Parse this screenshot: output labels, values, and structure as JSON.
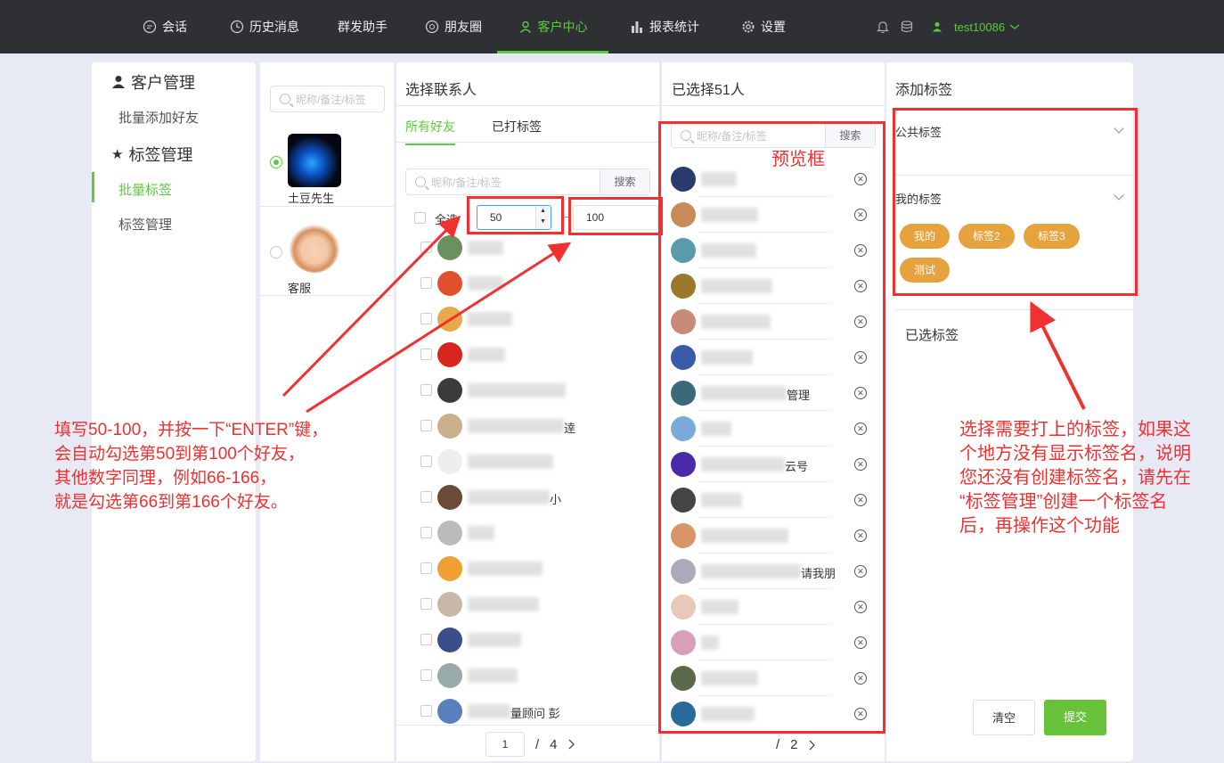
{
  "nav": {
    "items": [
      {
        "label": "会话",
        "icon": "chat-icon"
      },
      {
        "label": "历史消息",
        "icon": "clock-icon"
      },
      {
        "label": "群发助手",
        "icon": ""
      },
      {
        "label": "朋友圈",
        "icon": "aperture-icon"
      },
      {
        "label": "客户中心",
        "icon": "user-icon"
      },
      {
        "label": "报表统计",
        "icon": "bar-chart-icon"
      },
      {
        "label": "设置",
        "icon": "gear-icon"
      }
    ],
    "active_index": 4,
    "username": "test10086"
  },
  "sidebar": {
    "group1": "客户管理",
    "group1_items": [
      "批量添加好友"
    ],
    "group2": "标签管理",
    "group2_items": [
      "批量标签",
      "标签管理"
    ],
    "active_item": "批量标签"
  },
  "accounts": {
    "search_placeholder": "昵称/备注/标签",
    "list": [
      {
        "name": "土豆先生",
        "selected": true
      },
      {
        "name": "客服",
        "selected": false
      }
    ]
  },
  "contacts": {
    "title": "选择联系人",
    "tabs": [
      "所有好友",
      "已打标签"
    ],
    "search_placeholder": "昵称/备注/标签",
    "search_button": "搜索",
    "select_all": "全选",
    "range_from": "50",
    "range_to": "100",
    "visible_fragments": [
      "",
      "",
      "",
      "",
      "",
      "逹",
      "",
      "小",
      "",
      "",
      "",
      "",
      "",
      "量顾问 彭"
    ],
    "page_current": "1",
    "page_total": "4"
  },
  "selected": {
    "title": "已选择51人",
    "search_placeholder": "昵称/备注/标签",
    "search_button": "搜索",
    "visible_fragments": [
      "",
      "",
      "",
      "",
      "",
      "",
      "管理",
      "",
      "云号",
      "",
      "",
      "请我朋",
      "",
      "",
      "",
      ""
    ],
    "page_total": "2"
  },
  "tags": {
    "title": "添加标签",
    "public_label": "公共标签",
    "my_label": "我的标签",
    "my_tags": [
      "我的",
      "标签2",
      "标签3",
      "测试"
    ],
    "selected_label": "已选标签",
    "clear_button": "清空",
    "submit_button": "提交"
  },
  "annotations": {
    "left_note": [
      "填写50-100，并按一下“ENTER”键，",
      "会自动勾选第50到第100个好友，",
      "其他数字同理，例如66-166，",
      "就是勾选第66到第166个好友。"
    ],
    "preview_label": "预览框",
    "right_note": [
      "选择需要打上的标签，如果这",
      "个地方没有显示标签名，说明",
      "您还没有创建标签名，请先在",
      "“标签管理”创建一个标签名",
      "后，再操作这个功能"
    ]
  },
  "colors": {
    "accent": "#5ccb3f",
    "nav_bg": "#2f3033",
    "tag": "#e6a23c",
    "annotation": "#f03030"
  }
}
